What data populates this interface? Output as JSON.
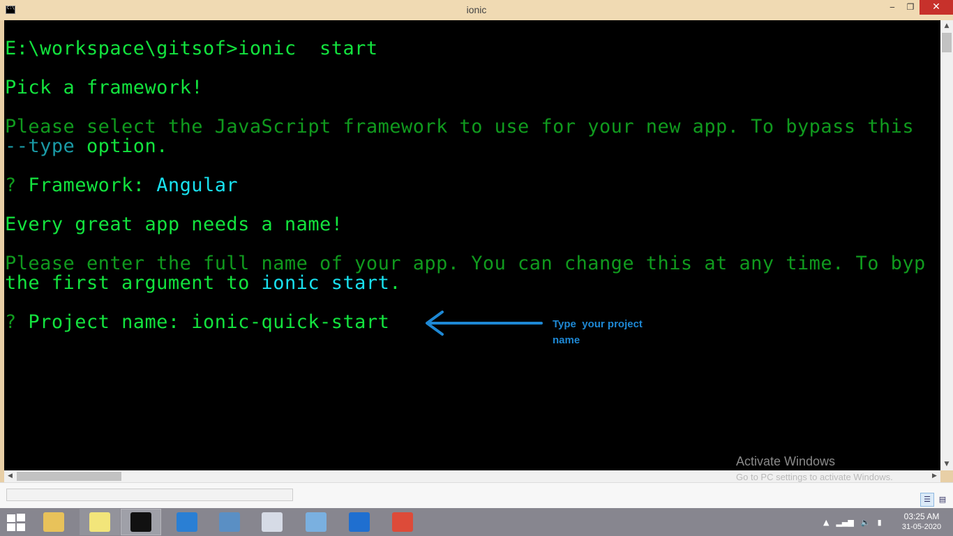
{
  "window": {
    "title": "ionic",
    "minimize_glyph": "‒",
    "maximize_glyph": "❐",
    "close_glyph": "✕"
  },
  "console": {
    "lines": [
      {
        "segments": [
          {
            "text": "E:\\workspace\\gitsof>ionic  start",
            "color": "bright"
          }
        ]
      },
      {
        "segments": [
          {
            "text": "Pick a framework!",
            "color": "bright"
          }
        ]
      },
      {
        "segments": [
          {
            "text": "Please select the JavaScript framework to use for your new app. To bypass this",
            "color": "dim"
          }
        ]
      },
      {
        "segments": [
          {
            "text": "--type",
            "color": "teal"
          },
          {
            "text": " option.",
            "color": "bright"
          }
        ]
      },
      {
        "segments": [
          {
            "text": "? ",
            "color": "dim"
          },
          {
            "text": "Framework: ",
            "color": "bright"
          },
          {
            "text": "Angular",
            "color": "cyan"
          }
        ]
      },
      {
        "segments": [
          {
            "text": "Every great app needs a name!",
            "color": "bright"
          }
        ]
      },
      {
        "segments": [
          {
            "text": "Please enter the full name of your app. You can change this at any time. To byp",
            "color": "dim"
          }
        ]
      },
      {
        "segments": [
          {
            "text": "the first argument to ",
            "color": "bright"
          },
          {
            "text": "ionic start",
            "color": "cyan"
          },
          {
            "text": ".",
            "color": "bright"
          }
        ]
      },
      {
        "segments": [
          {
            "text": "? ",
            "color": "dim"
          },
          {
            "text": "Project name: ionic-quick-start",
            "color": "bright"
          }
        ]
      }
    ]
  },
  "annotation": {
    "text": "Type  your project\nname",
    "color": "#1e88d4"
  },
  "watermark": {
    "title": "Activate Windows",
    "subtitle": "Go to PC settings to activate Windows."
  },
  "taskbar": {
    "items": [
      {
        "name": "file-explorer-icon",
        "state": "normal",
        "color": "#e8c25a"
      },
      {
        "name": "sticky-notes-icon",
        "state": "running",
        "color": "#f2e57a"
      },
      {
        "name": "command-prompt-icon",
        "state": "active",
        "color": "#111111"
      },
      {
        "name": "vscode-icon",
        "state": "normal",
        "color": "#2a7fd4"
      },
      {
        "name": "photo-viewer-icon",
        "state": "normal",
        "color": "#5a8fc4"
      },
      {
        "name": "calculator-icon",
        "state": "normal",
        "color": "#d6dbe6"
      },
      {
        "name": "media-icon",
        "state": "normal",
        "color": "#7ab0e0"
      },
      {
        "name": "mail-icon",
        "state": "normal",
        "color": "#1f6fd0"
      },
      {
        "name": "chrome-icon",
        "state": "normal",
        "color": "#dd4b39"
      }
    ],
    "clock_time": "03:25 AM",
    "clock_date": "31-05-2020"
  }
}
